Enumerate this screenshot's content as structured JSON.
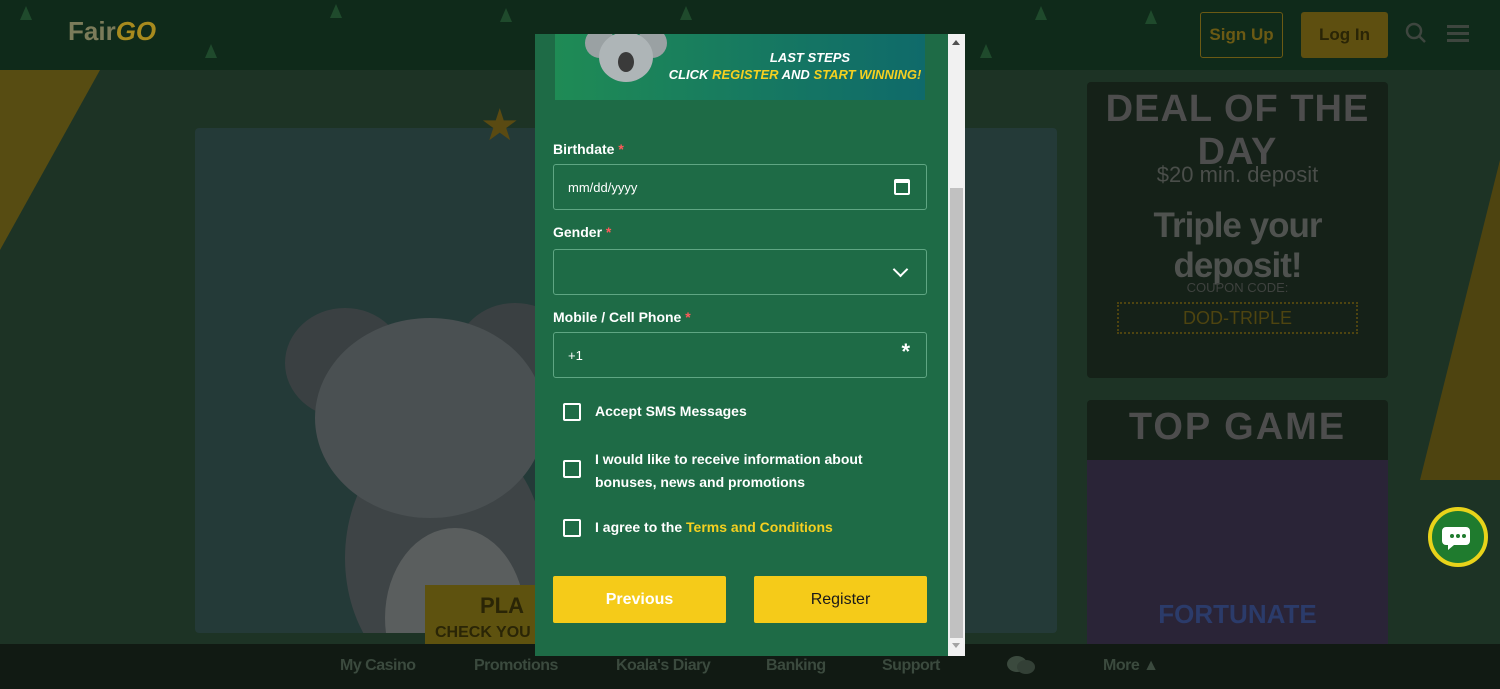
{
  "header": {
    "logo_text": "Fair",
    "logo_go": "GO",
    "signup_label": "Sign Up",
    "login_label": "Log In",
    "search_icon": "search-icon",
    "menu_icon": "hamburger-menu-icon"
  },
  "hero": {
    "play_label": "PLA",
    "play_sub": "CHECK YOU"
  },
  "deal_of_day": {
    "title": "DEAL OF THE DAY",
    "min_deposit": "$20 min. deposit",
    "headline": "Triple your deposit!",
    "coupon_label": "COUPON CODE:",
    "coupon_code": "DOD-TRIPLE"
  },
  "top_game": {
    "title": "TOP GAME",
    "game_name": "FORTUNATE"
  },
  "bottom_nav": {
    "items": [
      "My Casino",
      "Promotions",
      "Koala's Diary",
      "Banking",
      "Support"
    ],
    "more_label": "More ▲"
  },
  "modal": {
    "banner_line1": "LAST STEPS",
    "banner_line2_a": "CLICK ",
    "banner_line2_b": "REGISTER",
    "banner_line2_c": " AND ",
    "banner_line2_d": "START WINNING!",
    "birthdate_label": "Birthdate",
    "birthdate_placeholder": "mm/dd/yyyy",
    "gender_label": "Gender",
    "gender_value": "",
    "phone_label": "Mobile / Cell Phone",
    "phone_value": "+1",
    "required_mark": "*",
    "sms_label": "Accept SMS Messages",
    "info_label": "I would like to receive information about bonuses, news and promotions",
    "terms_prefix": "I agree to the ",
    "terms_link": "Terms and Conditions",
    "previous_label": "Previous",
    "register_label": "Register"
  },
  "colors": {
    "modal_bg": "#1e6b46",
    "accent_yellow": "#f5cb19",
    "link_yellow": "#f5d020",
    "required_red": "#ff5a5a"
  }
}
